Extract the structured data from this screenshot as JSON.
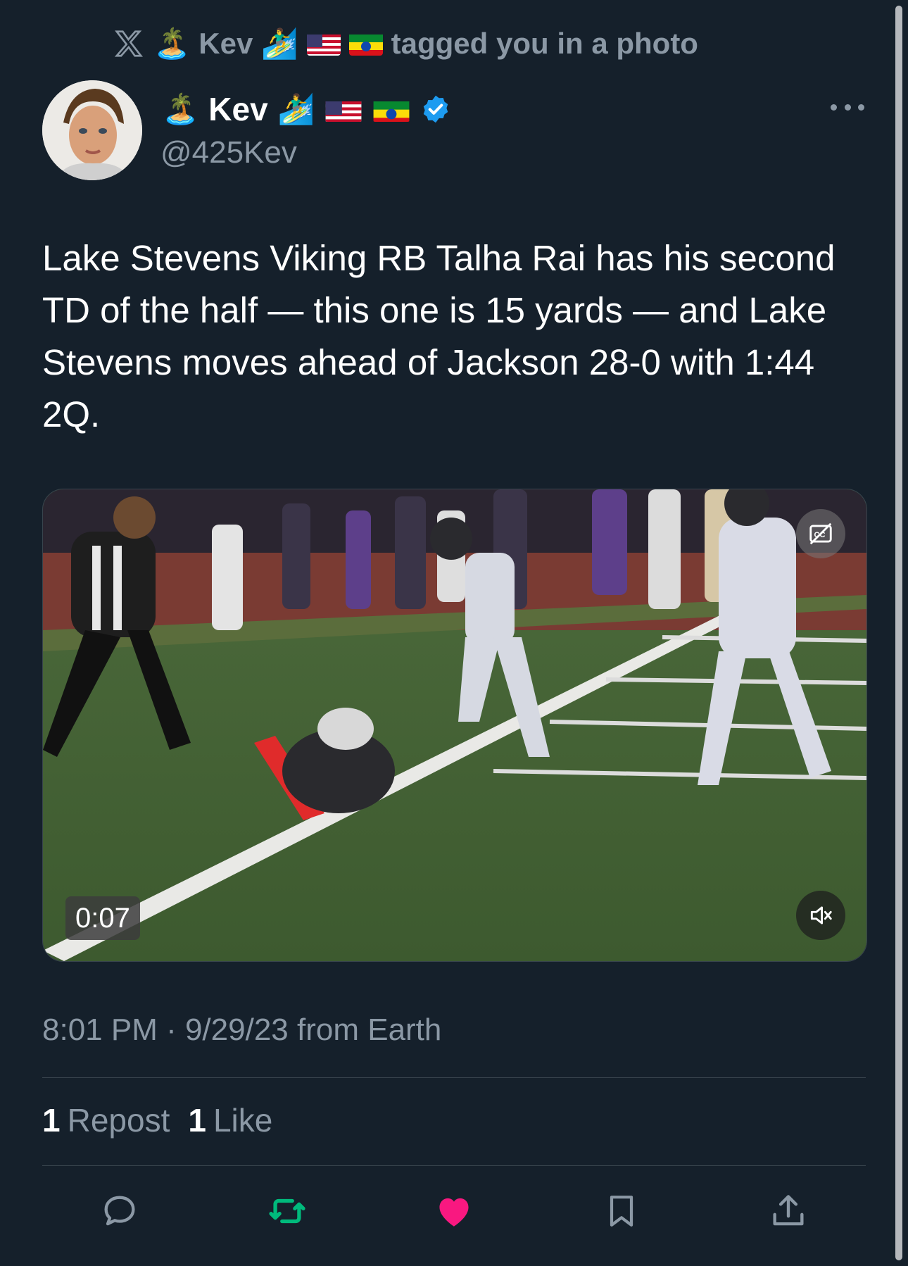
{
  "context": {
    "emoji_before": "🏝️",
    "name": "Kev",
    "emoji_after": "🏄‍♂️",
    "action_text": "tagged you in a photo"
  },
  "author": {
    "island_emoji": "🏝️",
    "display_name": "Kev",
    "surfer_emoji": "🏄‍♂️",
    "handle": "@425Kev",
    "verified_color": "#1d9bf0"
  },
  "tweet": {
    "text": "Lake Stevens Viking RB Talha Rai has his second TD of the half — this one is 15 yards — and Lake Stevens moves ahead of Jackson 28-0 with 1:44 2Q.",
    "timestamp": "8:01 PM · 9/29/23 from Earth"
  },
  "media": {
    "duration": "0:07",
    "cc_icon": "captions-off-icon",
    "mute_icon": "muted-speaker-icon"
  },
  "stats": {
    "reposts_count": "1",
    "reposts_label": "Repost",
    "likes_count": "1",
    "likes_label": "Like"
  },
  "colors": {
    "background": "#15202b",
    "secondary_text": "#8b98a5",
    "repost_green": "#00ba7c",
    "like_pink": "#f91880"
  }
}
